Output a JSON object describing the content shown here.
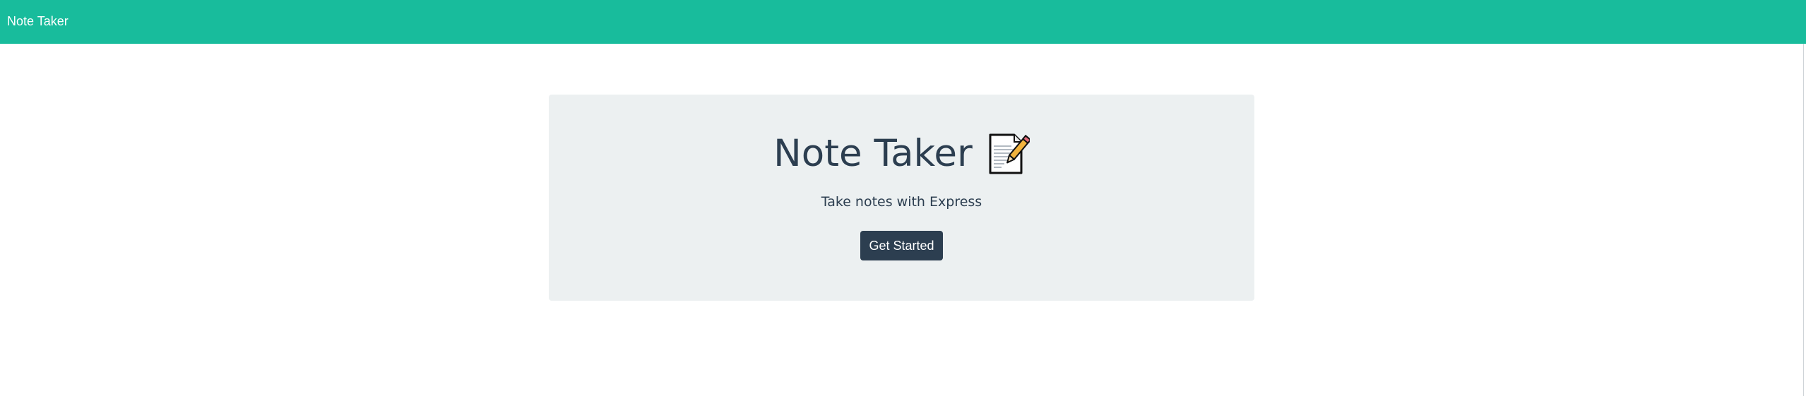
{
  "navbar": {
    "brand": "Note Taker",
    "background_color": "#18bc9c"
  },
  "hero": {
    "title": "Note Taker",
    "title_icon": "memo-icon",
    "subtitle": "Take notes with Express",
    "button_label": "Get Started",
    "background_color": "#ecf0f1",
    "button_color": "#2c3e50",
    "text_color": "#2c3e50"
  }
}
